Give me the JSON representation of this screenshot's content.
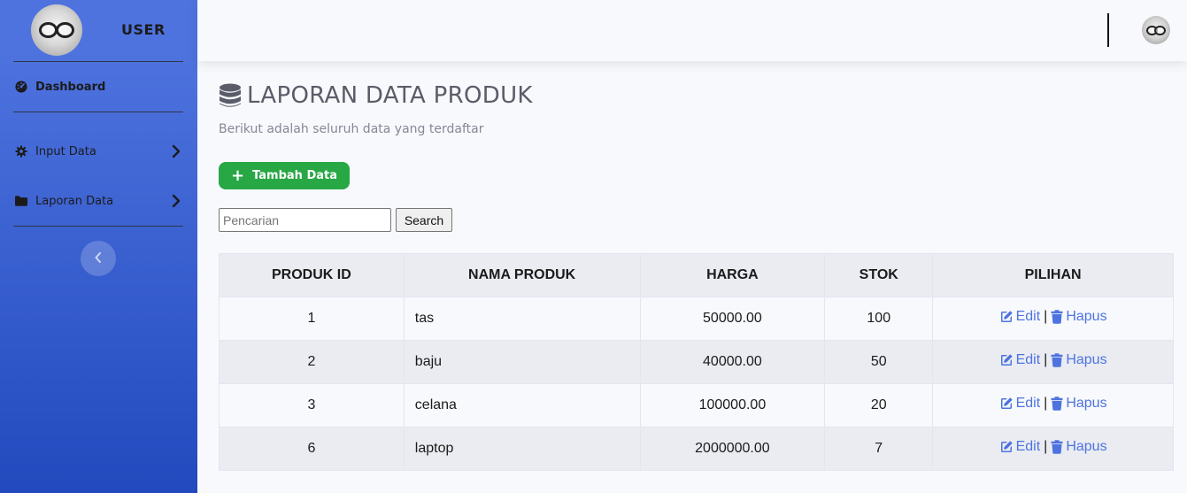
{
  "sidebar": {
    "brand": "USER",
    "items": [
      {
        "label": "Dashboard",
        "icon": "tachometer-icon"
      },
      {
        "label": "Input Data",
        "icon": "gear-icon"
      },
      {
        "label": "Laporan Data",
        "icon": "folder-icon"
      }
    ]
  },
  "page": {
    "title": "LAPORAN DATA PRODUK",
    "subtitle": "Berikut adalah seluruh data yang terdaftar",
    "add_button": "Tambah Data",
    "search_placeholder": "Pencarian",
    "search_button": "Search"
  },
  "table": {
    "headers": [
      "PRODUK ID",
      "NAMA PRODUK",
      "HARGA",
      "STOK",
      "PILIHAN"
    ],
    "rows": [
      {
        "id": "1",
        "name": "tas",
        "price": "50000.00",
        "stock": "100"
      },
      {
        "id": "2",
        "name": "baju",
        "price": "40000.00",
        "stock": "50"
      },
      {
        "id": "3",
        "name": "celana",
        "price": "100000.00",
        "stock": "20"
      },
      {
        "id": "6",
        "name": "laptop",
        "price": "2000000.00",
        "stock": "7"
      }
    ],
    "edit_label": "Edit",
    "separator": "|",
    "delete_label": "Hapus"
  },
  "colors": {
    "sidebar_start": "#4e73df",
    "sidebar_end": "#224abe",
    "success": "#28a745",
    "link": "#4e73df"
  }
}
